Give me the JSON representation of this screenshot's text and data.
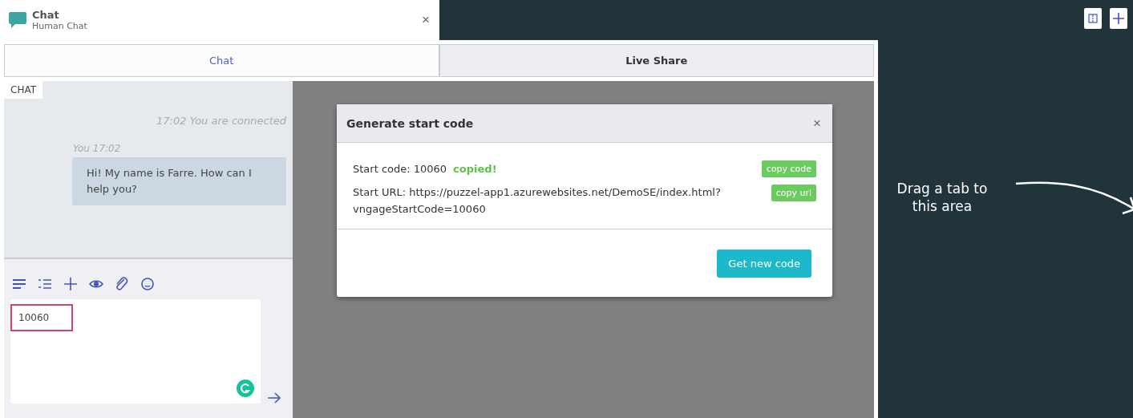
{
  "window": {
    "title": "Chat",
    "subtitle": "Human Chat",
    "close": "×"
  },
  "tabs": [
    {
      "label": "Chat",
      "selected": true
    },
    {
      "label": "Live Share",
      "selected": false
    }
  ],
  "chat": {
    "label": "CHAT",
    "status": "17:02 You are connected",
    "messages": [
      {
        "meta": "You 17:02",
        "text": "Hi! My name is Farre. How can I help you?"
      }
    ],
    "input": {
      "value": "10060"
    }
  },
  "dialog": {
    "title": "Generate start code",
    "close": "×",
    "code_label": "Start code: 10060",
    "copied": "copied!",
    "copy_code": "copy code",
    "url_label": "Start URL: https://puzzel-app1.azurewebsites.net/DemoSE/index.html?vngageStartCode=10060",
    "copy_url": "copy url",
    "new_code": "Get new code"
  },
  "drop_area": {
    "hint": "Drag a tab to this area"
  }
}
